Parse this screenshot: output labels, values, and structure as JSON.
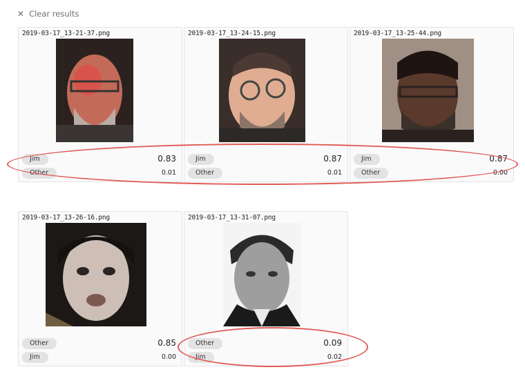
{
  "toolbar": {
    "clear_label": "Clear results",
    "clear_icon": "close-icon"
  },
  "results": [
    {
      "filename": "2019-03-17_13-21-37.png",
      "scores": [
        {
          "label": "Jim",
          "value": "0.83"
        },
        {
          "label": "Other",
          "value": "0.01"
        }
      ]
    },
    {
      "filename": "2019-03-17_13-24-15.png",
      "scores": [
        {
          "label": "Jim",
          "value": "0.87"
        },
        {
          "label": "Other",
          "value": "0.01"
        }
      ]
    },
    {
      "filename": "2019-03-17_13-25-44.png",
      "scores": [
        {
          "label": "Jim",
          "value": "0.87"
        },
        {
          "label": "Other",
          "value": "0.00"
        }
      ]
    },
    {
      "filename": "2019-03-17_13-26-16.png",
      "scores": [
        {
          "label": "Other",
          "value": "0.85"
        },
        {
          "label": "Jim",
          "value": "0.00"
        }
      ]
    },
    {
      "filename": "2019-03-17_13-31-07.png",
      "scores": [
        {
          "label": "Other",
          "value": "0.09"
        },
        {
          "label": "Jim",
          "value": "0.02"
        }
      ]
    }
  ],
  "colors": {
    "highlight": "#e05a55",
    "chip": "#e3e3e3"
  }
}
